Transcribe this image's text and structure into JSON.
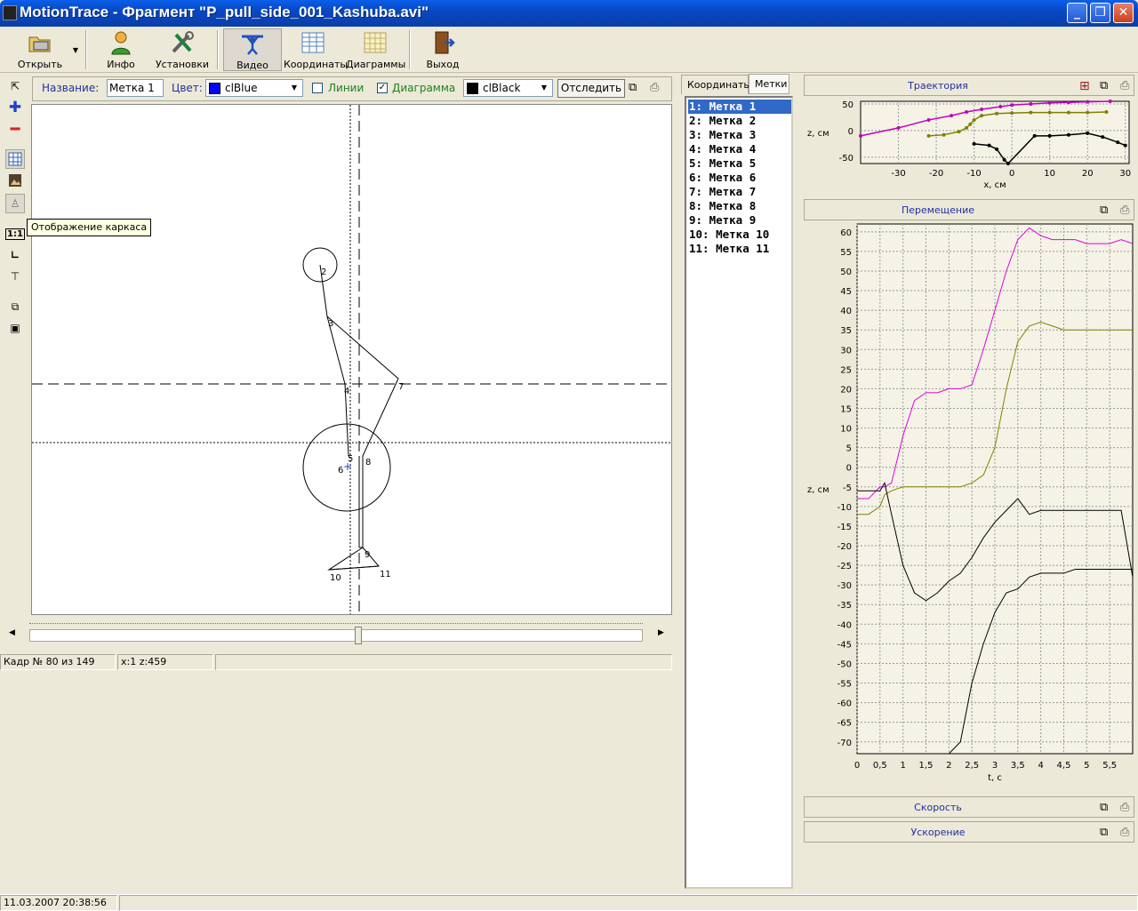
{
  "window": {
    "title": "MotionTrace - Фрагмент \"P_pull_side_001_Kashuba.avi\""
  },
  "toolbar": {
    "open": "Открыть",
    "info": "Инфо",
    "settings": "Установки",
    "video": "Видео",
    "coords": "Координаты",
    "diagrams": "Диаграммы",
    "exit": "Выход"
  },
  "marker_panel": {
    "name_label": "Название:",
    "name_value": "Метка 1",
    "color_label": "Цвет:",
    "color_value": "clBlue",
    "color_hex": "#0000ff",
    "lines_label": "Линии",
    "lines_checked": false,
    "diagram_label": "Диаграмма",
    "diagram_checked": true,
    "diagram_color": "clBlack",
    "diagram_color_hex": "#000000",
    "track_button": "Отследить"
  },
  "tooltip": "Отображение каркаса",
  "skeleton_labels": [
    "2",
    "3",
    "4",
    "5",
    "6",
    "7",
    "8",
    "9",
    "10",
    "11"
  ],
  "status": {
    "frame": "Кадр № 80 из 149",
    "coords": "x:1 z:459",
    "datetime": "11.03.2007 20:38:56"
  },
  "tabs": [
    "Координаты",
    "Метки"
  ],
  "markers": [
    "1: Метка 1",
    "2: Метка 2",
    "3: Метка 3",
    "4: Метка 4",
    "5: Метка 5",
    "6: Метка 6",
    "7: Метка 7",
    "8: Метка 8",
    "9: Метка 9",
    "10: Метка 10",
    "11: Метка 11"
  ],
  "panels": {
    "trajectory": "Траектория",
    "displacement": "Перемещение",
    "velocity": "Скорость",
    "acceleration": "Ускорение"
  },
  "chart_data": [
    {
      "type": "scatter",
      "title": "Траектория",
      "xlabel": "x, см",
      "ylabel": "z, см",
      "xlim": [
        -40,
        31
      ],
      "ylim": [
        -62,
        55
      ],
      "xticks": [
        "-30",
        "-20",
        "-10",
        "0",
        "10",
        "20",
        "30"
      ],
      "yticks": [
        "50",
        "0",
        "-50"
      ],
      "series": [
        {
          "color": "#c000c0",
          "points": [
            [
              -40,
              -10
            ],
            [
              -30,
              5
            ],
            [
              -22,
              20
            ],
            [
              -16,
              28
            ],
            [
              -12,
              35
            ],
            [
              -8,
              40
            ],
            [
              -3,
              45
            ],
            [
              0,
              48
            ],
            [
              5,
              50
            ],
            [
              10,
              52
            ],
            [
              15,
              53
            ],
            [
              20,
              54
            ],
            [
              26,
              55
            ]
          ]
        },
        {
          "color": "#808000",
          "points": [
            [
              -22,
              -10
            ],
            [
              -18,
              -8
            ],
            [
              -14,
              -2
            ],
            [
              -12,
              5
            ],
            [
              -11,
              12
            ],
            [
              -10,
              20
            ],
            [
              -8,
              28
            ],
            [
              -4,
              32
            ],
            [
              0,
              33
            ],
            [
              5,
              34
            ],
            [
              10,
              34
            ],
            [
              15,
              34
            ],
            [
              20,
              34
            ],
            [
              25,
              35
            ]
          ]
        },
        {
          "color": "#000000",
          "points": [
            [
              -10,
              -25
            ],
            [
              -6,
              -28
            ],
            [
              -4,
              -35
            ],
            [
              -2,
              -55
            ],
            [
              -1,
              -62
            ],
            [
              6,
              -10
            ],
            [
              10,
              -10
            ],
            [
              15,
              -8
            ],
            [
              20,
              -5
            ],
            [
              24,
              -12
            ],
            [
              28,
              -22
            ],
            [
              30,
              -28
            ]
          ]
        }
      ]
    },
    {
      "type": "line",
      "title": "Перемещение",
      "xlabel": "t, c",
      "ylabel": "z, см",
      "xlim": [
        0,
        6
      ],
      "ylim": [
        -73,
        62
      ],
      "xticks": [
        "0",
        "0,5",
        "1",
        "1,5",
        "2",
        "2,5",
        "3",
        "3,5",
        "4",
        "4,5",
        "5",
        "5,5"
      ],
      "yticks": [
        "60",
        "55",
        "50",
        "45",
        "40",
        "35",
        "30",
        "25",
        "20",
        "15",
        "10",
        "5",
        "0",
        "-5",
        "-10",
        "-15",
        "-20",
        "-25",
        "-30",
        "-35",
        "-40",
        "-45",
        "-50",
        "-55",
        "-60",
        "-65",
        "-70"
      ],
      "x": [
        0,
        0.25,
        0.5,
        0.6,
        0.75,
        1,
        1.25,
        1.5,
        1.75,
        2,
        2.25,
        2.5,
        2.75,
        3,
        3.25,
        3.5,
        3.75,
        4,
        4.25,
        4.5,
        4.75,
        5,
        5.25,
        5.5,
        5.75,
        6
      ],
      "series": [
        {
          "color": "#e000e0",
          "values": [
            -8,
            -8,
            -5,
            -5,
            -4,
            8,
            17,
            19,
            19,
            20,
            20,
            21,
            30,
            40,
            50,
            58,
            61,
            59,
            58,
            58,
            58,
            57,
            57,
            57,
            58,
            57
          ]
        },
        {
          "color": "#808000",
          "values": [
            -12,
            -12,
            -10,
            -7,
            -6,
            -5,
            -5,
            -5,
            -5,
            -5,
            -5,
            -4,
            -2,
            5,
            20,
            32,
            36,
            37,
            36,
            35,
            35,
            35,
            35,
            35,
            35,
            35
          ]
        },
        {
          "color": "#000000",
          "values": [
            -6,
            -6,
            -6,
            -4,
            -12,
            -25,
            -32,
            -34,
            -32,
            -29,
            -27,
            -23,
            -18,
            -14,
            -11,
            -8,
            -12,
            -11,
            -11,
            -11,
            -11,
            -11,
            -11,
            -11,
            -11,
            -28
          ]
        },
        {
          "color": "#000000",
          "values": [
            -73,
            -73,
            -73,
            -73,
            -73,
            -73,
            -73,
            -73,
            -73,
            -75,
            -70,
            -55,
            -45,
            -37,
            -32,
            -31,
            -28,
            -27,
            -27,
            -27,
            -26,
            -26,
            -26,
            -26,
            -26,
            -26
          ]
        }
      ]
    }
  ]
}
